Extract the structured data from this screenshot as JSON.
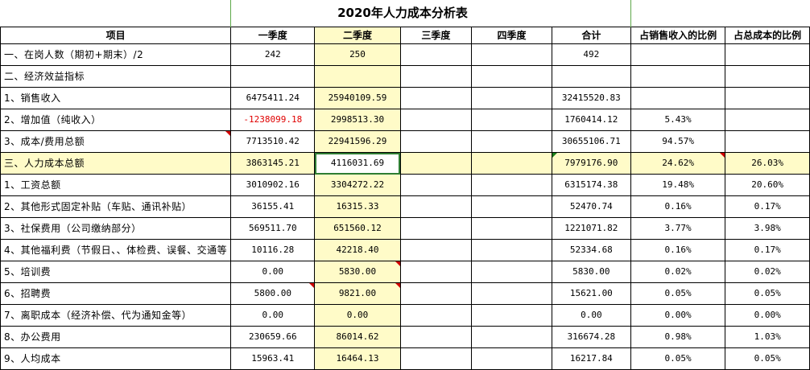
{
  "title": "2020年人力成本分析表",
  "headers": [
    "项目",
    "一季度",
    "二季度",
    "三季度",
    "四季度",
    "合计",
    "占销售收入的比例",
    "占总成本的比例"
  ],
  "rows": [
    {
      "label": "一、在岗人数（期初+期末）/2",
      "q1": "242",
      "q2": "250",
      "q3": "",
      "q4": "",
      "total": "492",
      "pct_sales": "",
      "pct_cost": ""
    },
    {
      "label": "二、经济效益指标",
      "q1": "",
      "q2": "",
      "q3": "",
      "q4": "",
      "total": "",
      "pct_sales": "",
      "pct_cost": ""
    },
    {
      "label": "1、销售收入",
      "q1": "6475411.24",
      "q2": "25940109.59",
      "q3": "",
      "q4": "",
      "total": "32415520.83",
      "pct_sales": "",
      "pct_cost": ""
    },
    {
      "label": "2、增加值（纯收入）",
      "q1": "-1238099.18",
      "q2": "2998513.30",
      "q3": "",
      "q4": "",
      "total": "1760414.12",
      "pct_sales": "5.43%",
      "pct_cost": ""
    },
    {
      "label": "3、成本/费用总额",
      "q1": "7713510.42",
      "q2": "22941596.29",
      "q3": "",
      "q4": "",
      "total": "30655106.71",
      "pct_sales": "94.57%",
      "pct_cost": ""
    },
    {
      "label": "三、人力成本总额",
      "q1": "3863145.21",
      "q2": "4116031.69",
      "q3": "",
      "q4": "",
      "total": "7979176.90",
      "pct_sales": "24.62%",
      "pct_cost": "26.03%"
    },
    {
      "label": "1、工资总额",
      "q1": "3010902.16",
      "q2": "3304272.22",
      "q3": "",
      "q4": "",
      "total": "6315174.38",
      "pct_sales": "19.48%",
      "pct_cost": "20.60%"
    },
    {
      "label": "2、其他形式固定补贴（车贴、通讯补贴）",
      "q1": "36155.41",
      "q2": "16315.33",
      "q3": "",
      "q4": "",
      "total": "52470.74",
      "pct_sales": "0.16%",
      "pct_cost": "0.17%"
    },
    {
      "label": "3、社保费用（公司缴纳部分）",
      "q1": "569511.70",
      "q2": "651560.12",
      "q3": "",
      "q4": "",
      "total": "1221071.82",
      "pct_sales": "3.77%",
      "pct_cost": "3.98%"
    },
    {
      "label": "4、其他福利费（节假日、、体检费、误餐、交通等",
      "q1": "10116.28",
      "q2": "42218.40",
      "q3": "",
      "q4": "",
      "total": "52334.68",
      "pct_sales": "0.16%",
      "pct_cost": "0.17%"
    },
    {
      "label": "5、培训费",
      "q1": "0.00",
      "q2": "5830.00",
      "q3": "",
      "q4": "",
      "total": "5830.00",
      "pct_sales": "0.02%",
      "pct_cost": "0.02%"
    },
    {
      "label": "6、招聘费",
      "q1": "5800.00",
      "q2": "9821.00",
      "q3": "",
      "q4": "",
      "total": "15621.00",
      "pct_sales": "0.05%",
      "pct_cost": "0.05%"
    },
    {
      "label": "7、离职成本（经济补偿、代为通知金等）",
      "q1": "0.00",
      "q2": "0.00",
      "q3": "",
      "q4": "",
      "total": "0.00",
      "pct_sales": "0.00%",
      "pct_cost": "0.00%"
    },
    {
      "label": "8、办公费用",
      "q1": "230659.66",
      "q2": "86014.62",
      "q3": "",
      "q4": "",
      "total": "316674.28",
      "pct_sales": "0.98%",
      "pct_cost": "1.03%"
    },
    {
      "label": "9、人均成本",
      "q1": "15963.41",
      "q2": "16464.13",
      "q3": "",
      "q4": "",
      "total": "16217.84",
      "pct_sales": "0.05%",
      "pct_cost": "0.05%"
    }
  ],
  "colors": {
    "highlight": "#fffbc8",
    "negative": "#e00000",
    "selection": "#2e7d32",
    "comment_marker": "#d00000"
  }
}
